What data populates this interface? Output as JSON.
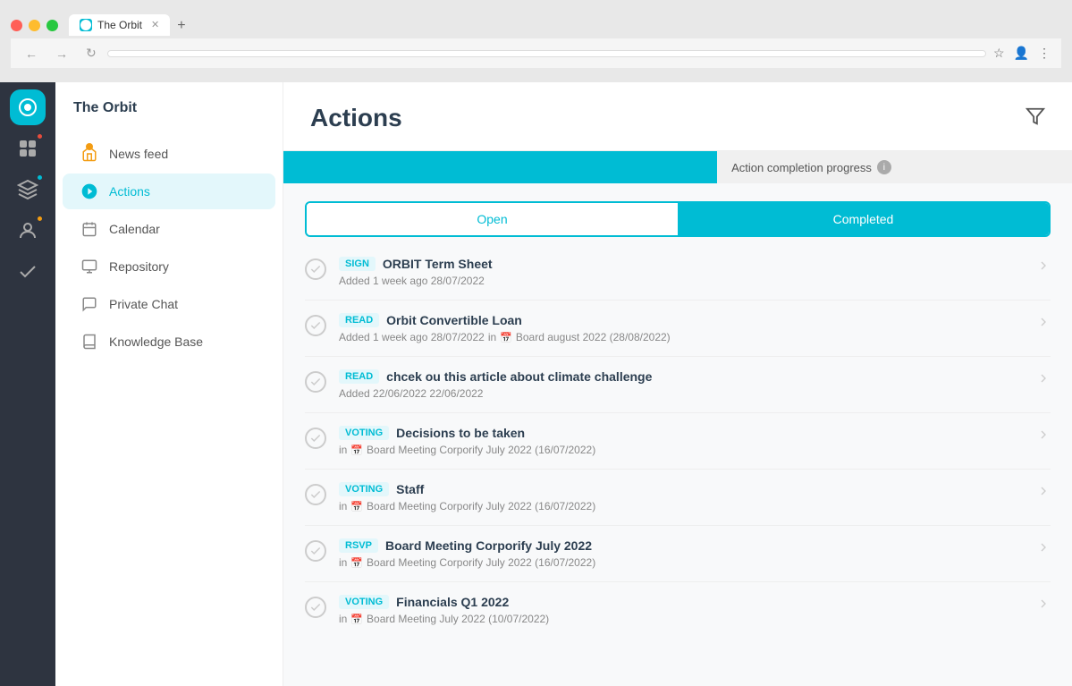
{
  "browser": {
    "tab_label": "The Orbit",
    "tab_icon": "orbit-icon",
    "url": "",
    "new_tab_label": "+",
    "back_btn": "←",
    "forward_btn": "→",
    "reload_btn": "↻"
  },
  "sidebar": {
    "app_title": "The Orbit",
    "items": [
      {
        "id": "news-feed",
        "label": "News feed",
        "icon": "home-icon",
        "badge": "orange",
        "active": false
      },
      {
        "id": "actions",
        "label": "Actions",
        "icon": "actions-icon",
        "badge": null,
        "active": true
      },
      {
        "id": "calendar",
        "label": "Calendar",
        "icon": "calendar-icon",
        "badge": null,
        "active": false
      },
      {
        "id": "repository",
        "label": "Repository",
        "icon": "repository-icon",
        "badge": null,
        "active": false
      },
      {
        "id": "private-chat",
        "label": "Private Chat",
        "icon": "chat-icon",
        "badge": null,
        "active": false
      },
      {
        "id": "knowledge-base",
        "label": "Knowledge Base",
        "icon": "knowledge-icon",
        "badge": null,
        "active": false
      }
    ]
  },
  "rail": {
    "icons": [
      {
        "id": "orbit-app",
        "badge": null
      },
      {
        "id": "app2",
        "badge": "red"
      },
      {
        "id": "app3",
        "badge": "blue"
      },
      {
        "id": "app4",
        "badge": "orange"
      },
      {
        "id": "app5",
        "badge": null
      }
    ]
  },
  "main": {
    "title": "Actions",
    "filter_icon": "filter-icon",
    "progress_label": "Action completion progress",
    "progress_percent": 55,
    "toggle": {
      "open_label": "Open",
      "completed_label": "Completed",
      "active": "completed"
    },
    "actions": [
      {
        "tag": "SIGN",
        "name": "ORBIT Term Sheet",
        "meta": "Added 1 week ago 28/07/2022",
        "calendar": false
      },
      {
        "tag": "READ",
        "name": "Orbit Convertible Loan",
        "meta": "Added 1 week ago 28/07/2022",
        "meta2": "in",
        "calendar_event": "Board august 2022 (28/08/2022)",
        "calendar": true
      },
      {
        "tag": "READ",
        "name": "chcek ou this article about climate challenge",
        "meta": "Added 22/06/2022 22/06/2022",
        "calendar": false
      },
      {
        "tag": "VOTING",
        "name": "Decisions to be taken",
        "meta": "in",
        "calendar_event": "Board Meeting Corporify July 2022 (16/07/2022)",
        "calendar": true
      },
      {
        "tag": "VOTING",
        "name": "Staff",
        "meta": "in",
        "calendar_event": "Board Meeting Corporify July 2022 (16/07/2022)",
        "calendar": true
      },
      {
        "tag": "RSVP",
        "name": "Board Meeting Corporify July 2022",
        "meta": "in",
        "calendar_event": "Board Meeting Corporify July 2022 (16/07/2022)",
        "calendar": true
      },
      {
        "tag": "VOTING",
        "name": "Financials Q1 2022",
        "meta": "in",
        "calendar_event": "Board Meeting July 2022 (10/07/2022)",
        "calendar": true
      }
    ]
  }
}
